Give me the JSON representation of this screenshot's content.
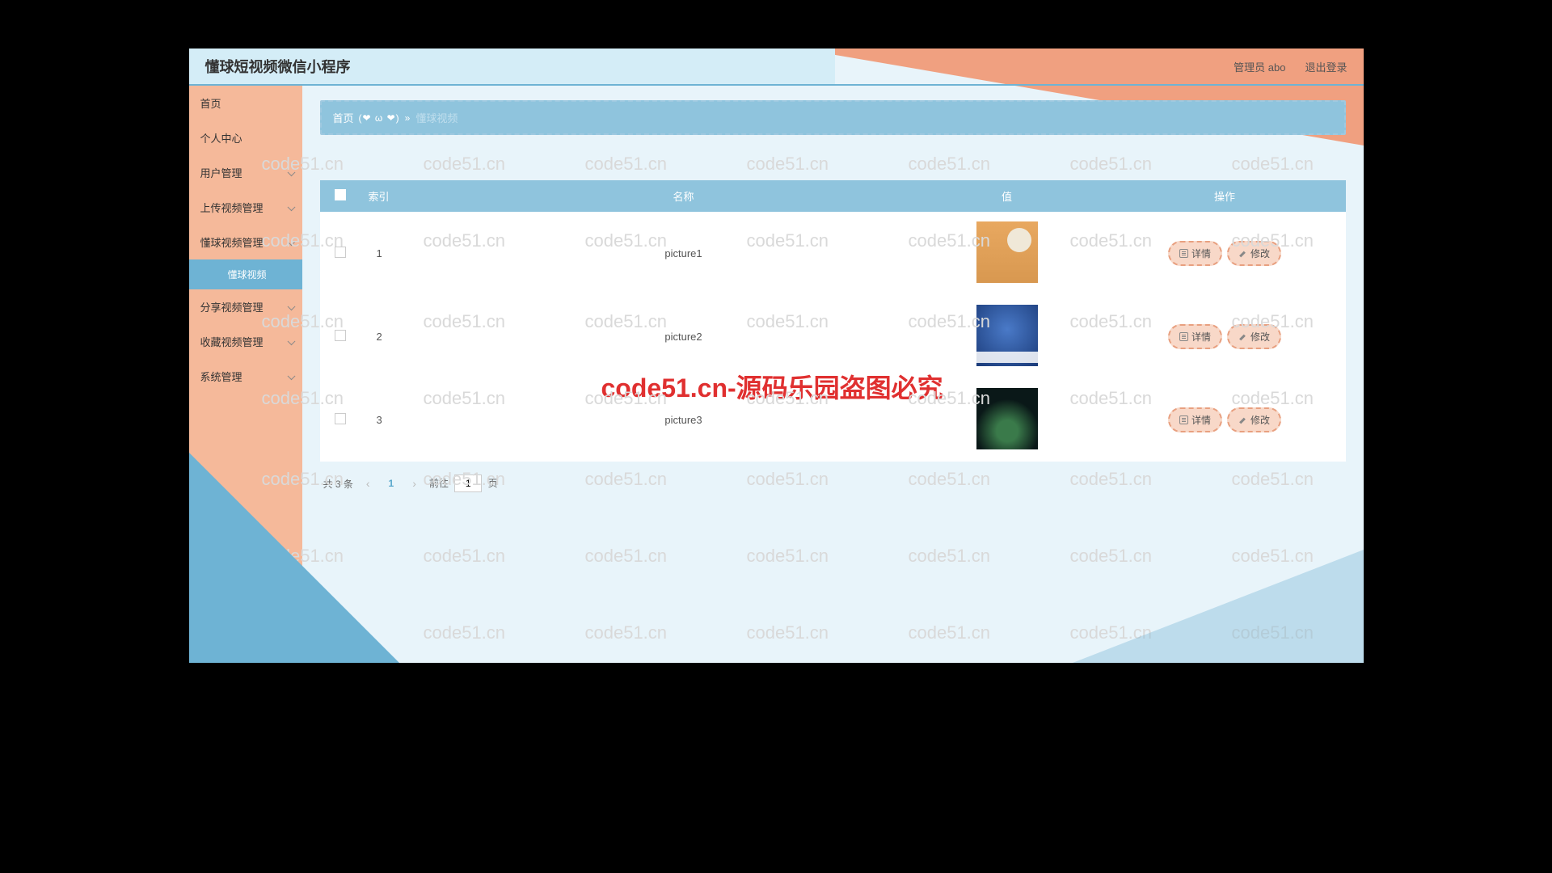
{
  "header": {
    "title": "懂球短视频微信小程序",
    "admin_label": "管理员 abo",
    "logout_label": "退出登录"
  },
  "sidebar": {
    "items": [
      {
        "label": "首页",
        "has_children": false
      },
      {
        "label": "个人中心",
        "has_children": false
      },
      {
        "label": "用户管理",
        "has_children": true
      },
      {
        "label": "上传视频管理",
        "has_children": true
      },
      {
        "label": "懂球视频管理",
        "has_children": true,
        "open": true,
        "children": [
          {
            "label": "懂球视频"
          }
        ]
      },
      {
        "label": "分享视频管理",
        "has_children": true
      },
      {
        "label": "收藏视频管理",
        "has_children": true
      },
      {
        "label": "系统管理",
        "has_children": true
      }
    ]
  },
  "breadcrumb": {
    "home": "首页",
    "decor": "(❤ ω ❤)",
    "sep": "»",
    "current": "懂球视频"
  },
  "table": {
    "columns": {
      "index": "索引",
      "name": "名称",
      "value": "值",
      "action": "操作"
    },
    "rows": [
      {
        "index": "1",
        "name": "picture1",
        "thumb": "thumb1"
      },
      {
        "index": "2",
        "name": "picture2",
        "thumb": "thumb2"
      },
      {
        "index": "3",
        "name": "picture3",
        "thumb": "thumb3"
      }
    ],
    "actions": {
      "detail": "详情",
      "edit": "修改"
    }
  },
  "pagination": {
    "total_text": "共 3 条",
    "current": "1",
    "goto_prefix": "前往",
    "goto_value": "1",
    "goto_suffix": "页"
  },
  "watermark": {
    "text": "code51.cn",
    "center": "code51.cn-源码乐园盗图必究"
  }
}
